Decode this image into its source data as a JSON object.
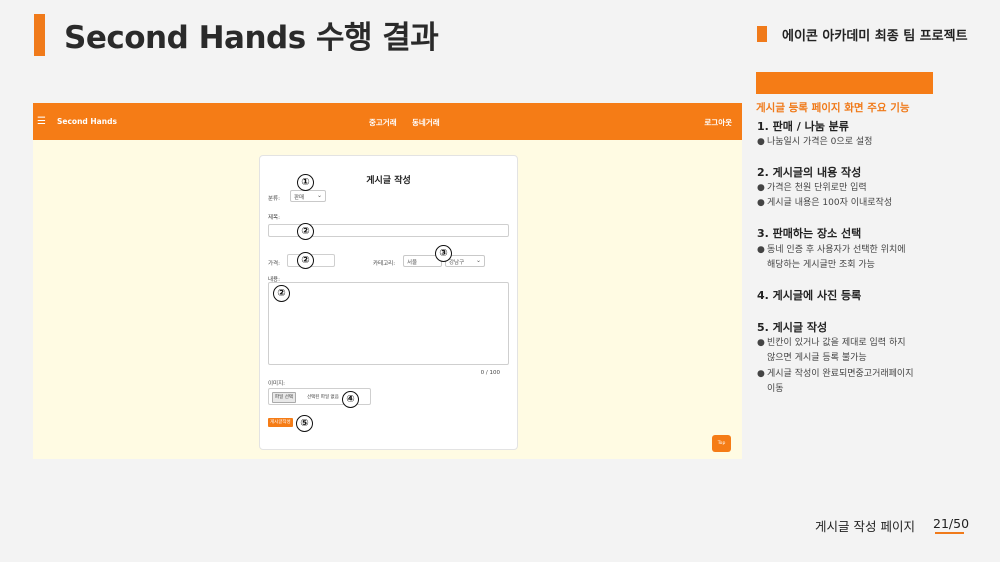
{
  "slide": {
    "title": "Second Hands 수행 결과",
    "project_label": "에이콘 아카데미 최종 팀 프로젝트",
    "footer_label": "게시글 작성 페이지",
    "page_number": "21/50",
    "accent_color": "#f07a1a"
  },
  "screenshot": {
    "nav": {
      "menu_icon": "☰",
      "brand": "Second Hands",
      "links": [
        "중고거래",
        "동네거래"
      ],
      "login": "로그아웃",
      "color": "#f57c16"
    },
    "form": {
      "title": "게시글 작성",
      "category_label": "분류:",
      "category_value": "판매",
      "title_label": "제목:",
      "price_label": "가격:",
      "region_label": "카테고리:",
      "city_value": "서울",
      "district_value": "강남구",
      "content_label": "내용:",
      "counter": "0 / 100",
      "image_label": "이미지:",
      "file_button": "파일 선택",
      "file_none": "선택된 파일 없음",
      "submit": "게시글작성"
    },
    "markers": [
      "①",
      "②",
      "②",
      "②",
      "③",
      "④",
      "⑤"
    ],
    "top_button": "Top"
  },
  "side": {
    "caption": "게시글 등록 페이지 화면 주요 기능",
    "features": [
      {
        "heading": "1. 판매 / 나눔 분류",
        "bullets": [
          "나눔일시 가격은 0으로 설정"
        ]
      },
      {
        "heading": "2. 게시글의 내용 작성",
        "bullets": [
          "가격은 천원 단위로만 입력",
          "게시글 내용은 100자 이내로작성"
        ]
      },
      {
        "heading": "3. 판매하는 장소 선택",
        "bullets": [
          "동네 인증 후 사용자가 선택한 위치에",
          "해당하는 게시글만 조회 가능"
        ]
      },
      {
        "heading": "4. 게시글에 사진  등록",
        "bullets": []
      },
      {
        "heading": "5. 게시글 작성",
        "bullets": [
          "빈칸이 있거나 값을 제대로 입력 하지",
          "않으면 게시글 등록 불가능",
          "게시글 작성이 완료되면중고거래페이지",
          "이동"
        ]
      }
    ]
  }
}
